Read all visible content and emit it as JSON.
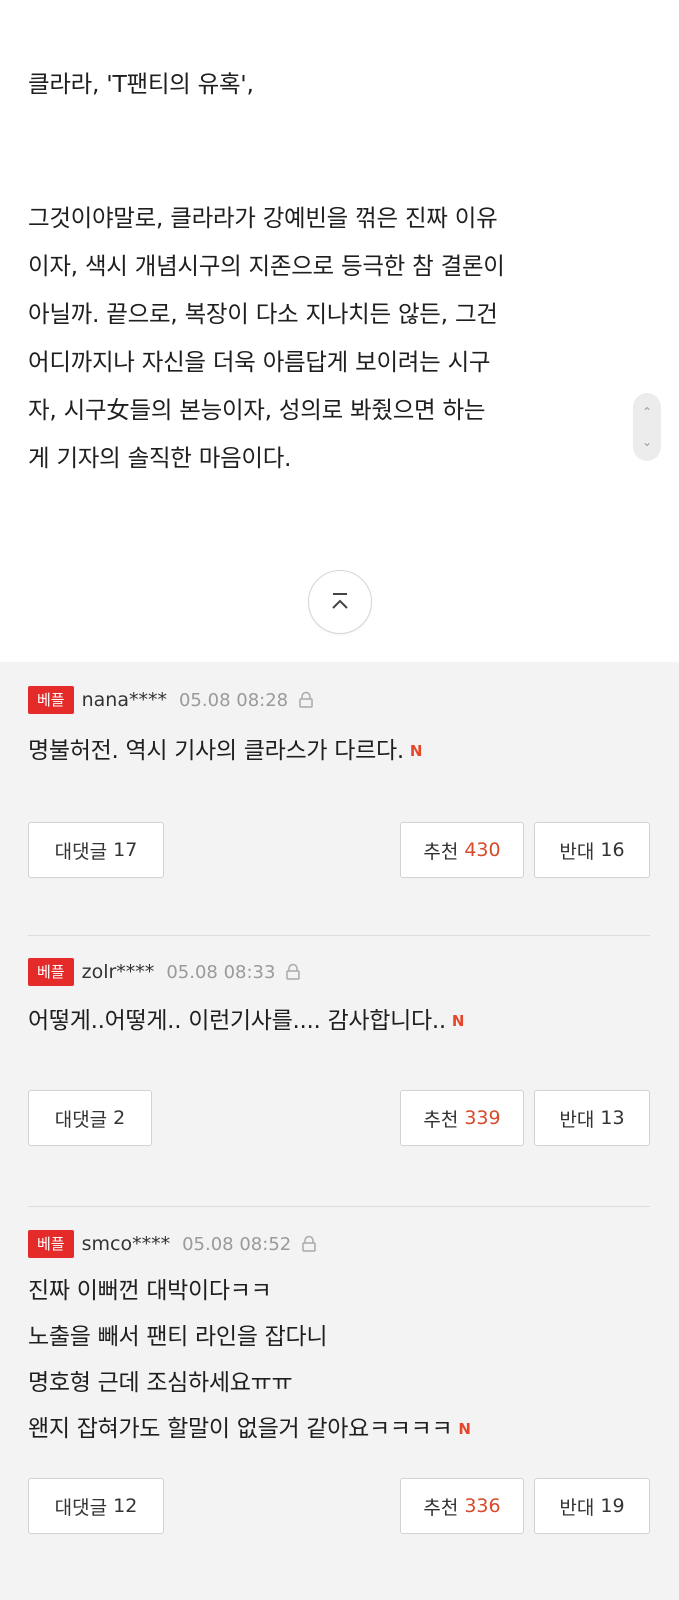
{
  "article": {
    "para1": [
      "클라라, 'T팬티의 유혹',"
    ],
    "para2": [
      "그것이야말로, 클라라가 강예빈을 꺾은 진짜 이유",
      "이자, 색시 개념시구의 지존으로 등극한 참 결론이",
      "아닐까. 끝으로, 복장이 다소 지나치든 않든, 그건",
      "어디까지나 자신을 더욱 아름답게 보이려는 시구",
      "자, 시구女들의 본능이자, 성의로 봐줬으면 하는",
      "게 기자의 솔직한 마음이다."
    ]
  },
  "comments": [
    {
      "badge": "베플",
      "nick": "nana****",
      "time": "05.08 08:28",
      "lines": [
        "명불허전. 역시 기사의 클라스가 다르다."
      ],
      "new_mark": "N",
      "reply_label": "대댓글",
      "reply_count": "17",
      "like_label": "추천",
      "like_count": "430",
      "dislike_label": "반대",
      "dislike_count": "16"
    },
    {
      "badge": "베플",
      "nick": "zolr****",
      "time": "05.08 08:33",
      "lines": [
        "어떻게..어떻게.. 이런기사를.... 감사합니다.."
      ],
      "new_mark": "N",
      "reply_label": "대댓글",
      "reply_count": "2",
      "like_label": "추천",
      "like_count": "339",
      "dislike_label": "반대",
      "dislike_count": "13"
    },
    {
      "badge": "베플",
      "nick": "smco****",
      "time": "05.08 08:52",
      "lines": [
        "진짜 이뻐껀 대박이다ㅋㅋ",
        "노출을 빼서 팬티 라인을 잡다니",
        "명호형 근데 조심하세요ㅠㅠ",
        "왠지 잡혀가도 할말이 없을거 같아요ㅋㅋㅋㅋ"
      ],
      "new_mark": "N",
      "reply_label": "대댓글",
      "reply_count": "12",
      "like_label": "추천",
      "like_count": "336",
      "dislike_label": "반대",
      "dislike_count": "19"
    }
  ],
  "icons": {
    "scroll_up": "⌃",
    "scroll_down": "⌄",
    "top_button": "chevron-up-icon",
    "lock": "lock-icon"
  },
  "colors": {
    "badge": "#e52a2a",
    "like_count": "#d64b2a",
    "new_mark": "#e5472a",
    "comments_bg": "#f3f3f3"
  }
}
